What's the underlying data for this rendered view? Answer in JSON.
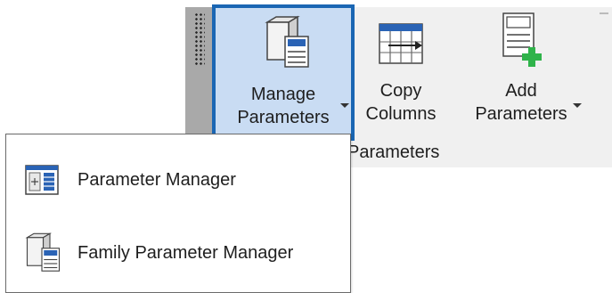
{
  "ribbon": {
    "buttons": [
      {
        "label_line1": "Manage",
        "label_line2": "Parameters",
        "icon": "manage-parameters-icon",
        "selected": true
      },
      {
        "label_line1": "Copy",
        "label_line2": "Columns",
        "icon": "copy-columns-icon",
        "selected": false
      },
      {
        "label_line1": "Add",
        "label_line2": "Parameters",
        "icon": "add-parameters-icon",
        "selected": false
      }
    ],
    "panel_label": "Parameters"
  },
  "dropdown": {
    "items": [
      {
        "label": "Parameter Manager",
        "icon": "parameter-manager-icon"
      },
      {
        "label": "Family Parameter Manager",
        "icon": "family-parameter-manager-icon"
      }
    ]
  },
  "colors": {
    "selection_border": "#1a66b3",
    "selection_fill": "#c9dcf3",
    "ribbon_bg": "#f0f0f0",
    "grip_bg": "#a9a9a9",
    "accent_green": "#2fb34a"
  }
}
